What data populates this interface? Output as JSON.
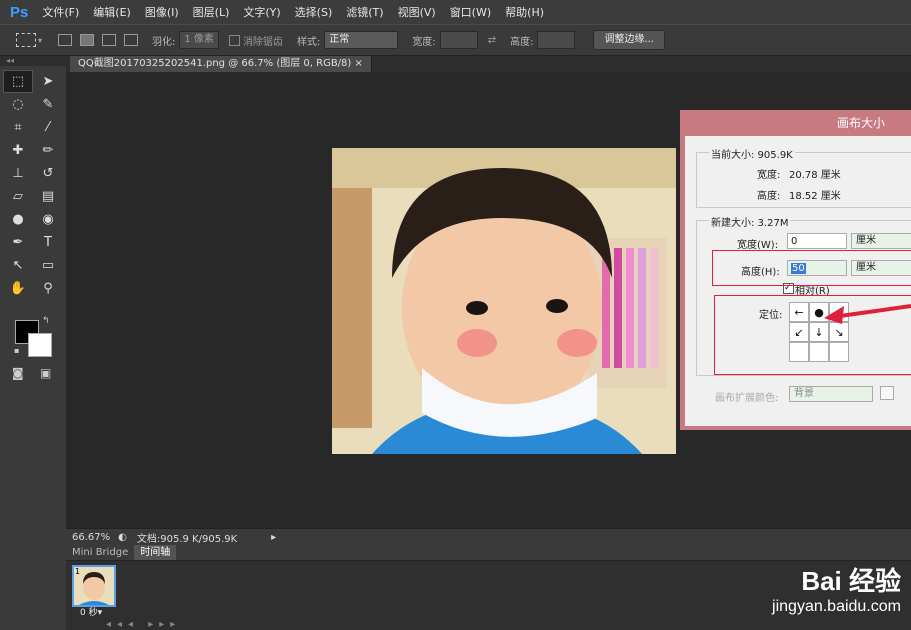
{
  "app": {
    "logo": "Ps"
  },
  "menu": [
    "文件(F)",
    "编辑(E)",
    "图像(I)",
    "图层(L)",
    "文字(Y)",
    "选择(S)",
    "滤镜(T)",
    "视图(V)",
    "窗口(W)",
    "帮助(H)"
  ],
  "options": {
    "feather_label": "羽化:",
    "feather_value": "1 像素",
    "antialias_label": "消除锯齿",
    "style_label": "样式:",
    "style_value": "正常",
    "width_label": "宽度:",
    "height_label": "高度:",
    "refine_button": "调整边缘..."
  },
  "document": {
    "tab_title": "QQ截图20170325202541.png @ 66.7% (图层 0, RGB/8) ×"
  },
  "status": {
    "zoom": "66.67%",
    "doc_info": "文档:905.9 K/905.9K"
  },
  "panels": {
    "tabs": [
      "Mini Bridge",
      "时间轴"
    ],
    "active": "时间轴"
  },
  "timeline": {
    "frame_number": "1",
    "frame_duration": "0 秒▾"
  },
  "dialog": {
    "title": "画布大小",
    "current_label": "当前大小: 905.9K",
    "current_width_label": "宽度:",
    "current_width_value": "20.78 厘米",
    "current_height_label": "高度:",
    "current_height_value": "18.52 厘米",
    "new_label": "新建大小: 3.27M",
    "width_label": "宽度(W):",
    "width_value": "0",
    "width_unit": "厘米",
    "height_label": "高度(H):",
    "height_value": "50",
    "height_unit": "厘米",
    "relative_label": "相对(R)",
    "anchor_label": "定位:",
    "extension_label": "画布扩展颜色:",
    "extension_value": "背景"
  },
  "watermark": {
    "brand": "Bai 经验",
    "url": "jingyan.baidu.com"
  },
  "colors": {
    "accent": "#3aa0ff",
    "dialog_title_bar": "#c77b80",
    "highlight_box": "#e0203a"
  }
}
